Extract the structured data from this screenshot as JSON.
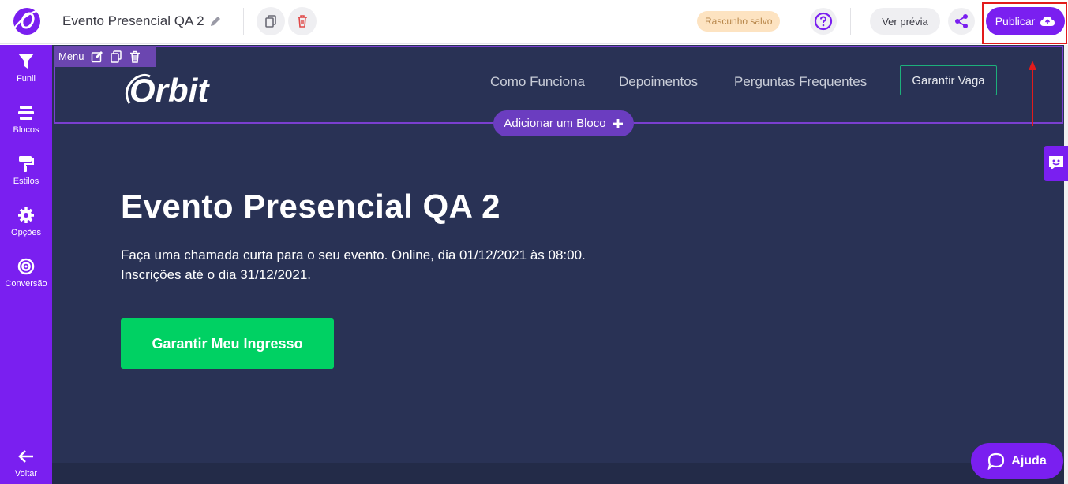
{
  "header": {
    "title": "Evento Presencial QA 2",
    "draft_badge": "Rascunho salvo",
    "preview_label": "Ver prévia",
    "publish_label": "Publicar"
  },
  "sidebar": {
    "items": [
      {
        "label": "Funil",
        "icon": "funnel-icon"
      },
      {
        "label": "Blocos",
        "icon": "blocks-icon"
      },
      {
        "label": "Estilos",
        "icon": "paint-roller-icon"
      },
      {
        "label": "Opções",
        "icon": "gear-icon"
      },
      {
        "label": "Conversão",
        "icon": "target-icon"
      }
    ],
    "back_label": "Voltar"
  },
  "canvas": {
    "block_tag": "Menu",
    "logo_text": "Orbit",
    "nav_items": [
      "Como Funciona",
      "Depoimentos",
      "Perguntas Frequentes"
    ],
    "nav_cta": "Garantir Vaga",
    "add_block_label": "Adicionar um Bloco",
    "hero_title": "Evento Presencial QA 2",
    "hero_desc_line1": "Faça uma chamada curta para o seu evento. Online, dia 01/12/2021 às 08:00.",
    "hero_desc_line2": "Inscrições até o dia 31/12/2021.",
    "hero_cta": "Garantir Meu Ingresso"
  },
  "help_widget": {
    "label": "Ajuda"
  },
  "colors": {
    "brand": "#7a1ff0",
    "canvas_bg": "#293255",
    "cta_green": "#00d163",
    "highlight_red": "#e21b1b"
  }
}
